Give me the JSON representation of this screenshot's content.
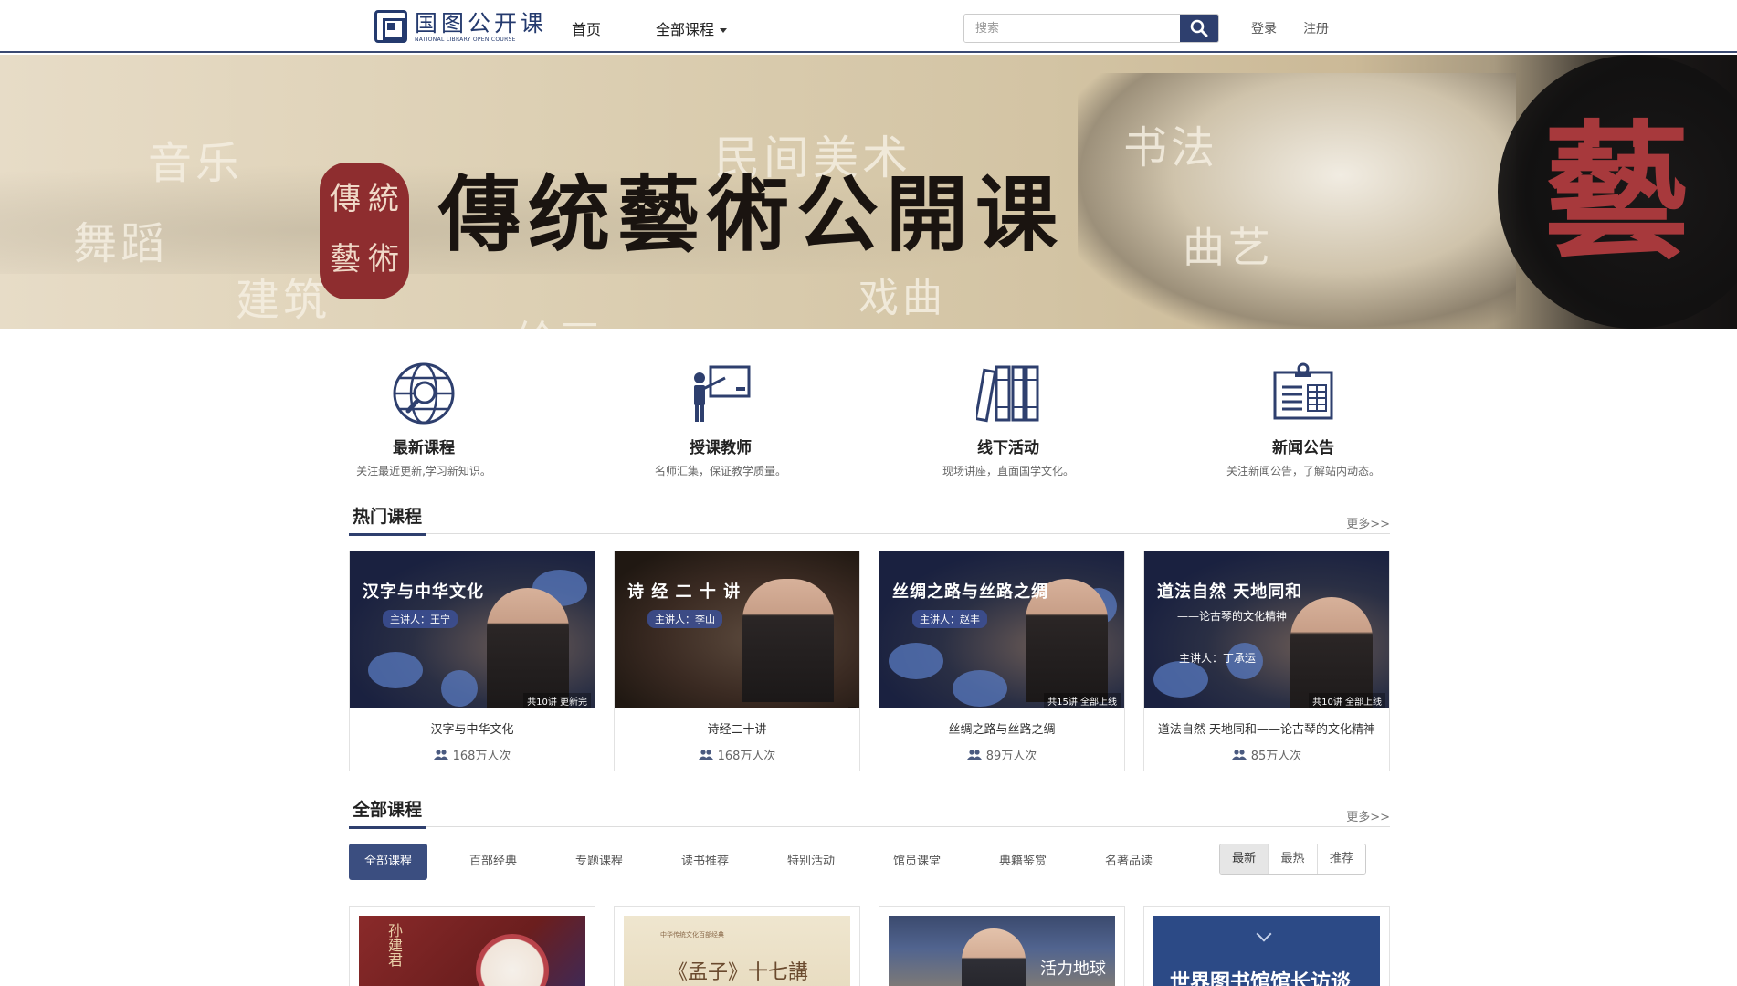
{
  "header": {
    "logo_cn": "国图公开课",
    "logo_en": "NATIONAL LIBRARY OPEN COURSE",
    "nav": {
      "home": "首页",
      "all_courses": "全部课程"
    },
    "search": {
      "placeholder": "搜索",
      "value": ""
    },
    "login": "登录",
    "register": "注册"
  },
  "banner": {
    "title": "傳统藝術公開课",
    "seal_chars": [
      "傳",
      "統",
      "藝",
      "術"
    ],
    "keywords": {
      "music": "音乐",
      "dance": "舞蹈",
      "architecture": "建筑",
      "painting": "绘画",
      "folk_art": "民间美术",
      "opera": "戏曲",
      "calligraphy": "书法",
      "quyi": "曲艺"
    },
    "big_char": "藝",
    "slides_total": 3,
    "active_slide": 2
  },
  "features": [
    {
      "icon": "globe-search-icon",
      "title": "最新课程",
      "desc": "关注最近更新,学习新知识。"
    },
    {
      "icon": "teacher-board-icon",
      "title": "授课教师",
      "desc": "名师汇集，保证教学质量。"
    },
    {
      "icon": "books-icon",
      "title": "线下活动",
      "desc": "现场讲座，直面国学文化。"
    },
    {
      "icon": "clipboard-news-icon",
      "title": "新闻公告",
      "desc": "关注新闻公告，了解站内动态。"
    }
  ],
  "hot": {
    "title": "热门课程",
    "more": "更多>>",
    "cards": [
      {
        "thumb_title": "汉字与中华文化",
        "thumb_sub": "主讲人：王宁",
        "thumb_count": "共10讲  更新完",
        "name": "汉字与中华文化",
        "views": "168万人次"
      },
      {
        "thumb_title": "诗 经 二 十 讲",
        "thumb_sub": "主讲人：李山",
        "thumb_count": "",
        "name": "诗经二十讲",
        "views": "168万人次"
      },
      {
        "thumb_title": "丝绸之路与丝路之绸",
        "thumb_sub": "主讲人：赵丰",
        "thumb_count": "共15讲  全部上线",
        "name": "丝绸之路与丝路之绸",
        "views": "89万人次"
      },
      {
        "thumb_title": "道法自然  天地同和",
        "thumb_sub": "——论古琴的文化精神",
        "thumb_sub2": "主讲人：丁承运",
        "thumb_count": "共10讲  全部上线",
        "name": "道法自然 天地同和——论古琴的文化精神",
        "views": "85万人次"
      }
    ]
  },
  "all": {
    "title": "全部课程",
    "more": "更多>>",
    "categories": [
      "全部课程",
      "百部经典",
      "专题课程",
      "读书推荐",
      "特别活动",
      "馆员课堂",
      "典籍鉴赏",
      "名著品读"
    ],
    "active_category": 0,
    "sort": [
      "最新",
      "最热",
      "推荐"
    ],
    "active_sort": 0,
    "cards": [
      {
        "thumb_text": "孙建君"
      },
      {
        "thumb_text": "《孟子》十七講",
        "thumb_text2": "中华传统文化百部经典"
      },
      {
        "thumb_text": "活力地球"
      },
      {
        "thumb_text": "世界图书馆馆长访谈"
      }
    ]
  },
  "colors": {
    "primary": "#2e3f6e",
    "active_tab": "#3b4e80",
    "seal_red": "#8e2d2f"
  }
}
